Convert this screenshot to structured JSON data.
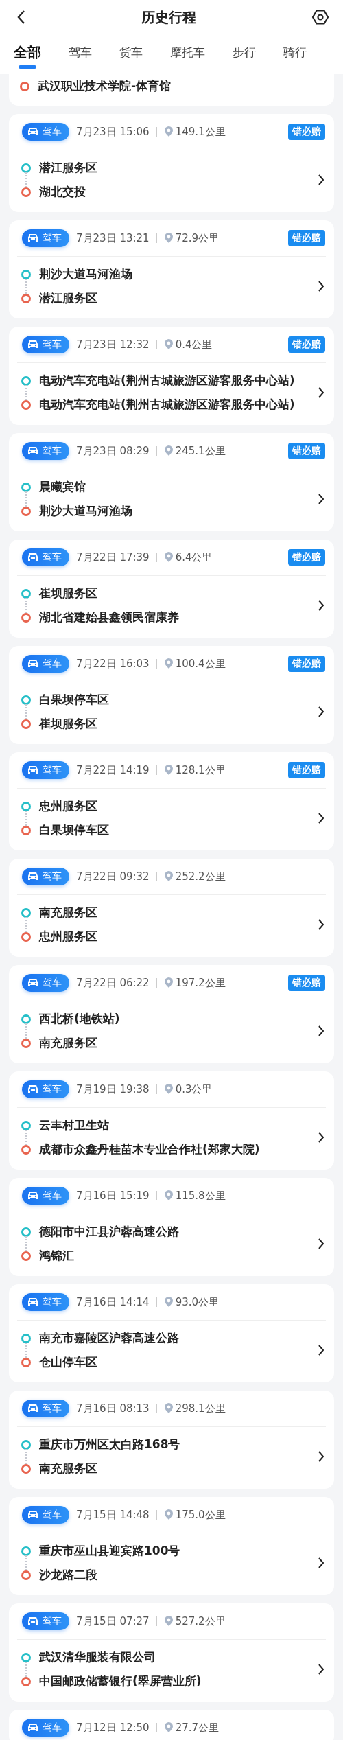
{
  "header": {
    "title": "历史行程"
  },
  "tabs": [
    {
      "label": "全部",
      "selected": true
    },
    {
      "label": "驾车",
      "selected": false
    },
    {
      "label": "货车",
      "selected": false
    },
    {
      "label": "摩托车",
      "selected": false
    },
    {
      "label": "步行",
      "selected": false
    },
    {
      "label": "骑行",
      "selected": false
    }
  ],
  "partial_trip": {
    "end": "武汉职业技术学院-体育馆"
  },
  "trips": [
    {
      "mode": "驾车",
      "time": "7月23日 15:06",
      "distance": "149.1公里",
      "badge": "错必赔",
      "start": "潜江服务区",
      "end": "湖北交投"
    },
    {
      "mode": "驾车",
      "time": "7月23日 13:21",
      "distance": "72.9公里",
      "badge": "错必赔",
      "start": "荆沙大道马河渔场",
      "end": "潜江服务区"
    },
    {
      "mode": "驾车",
      "time": "7月23日 12:32",
      "distance": "0.4公里",
      "badge": "错必赔",
      "start": "电动汽车充电站(荆州古城旅游区游客服务中心站)",
      "end": "电动汽车充电站(荆州古城旅游区游客服务中心站)"
    },
    {
      "mode": "驾车",
      "time": "7月23日 08:29",
      "distance": "245.1公里",
      "badge": "错必赔",
      "start": "晨曦宾馆",
      "end": "荆沙大道马河渔场"
    },
    {
      "mode": "驾车",
      "time": "7月22日 17:39",
      "distance": "6.4公里",
      "badge": "错必赔",
      "start": "崔坝服务区",
      "end": "湖北省建始县鑫领民宿康养"
    },
    {
      "mode": "驾车",
      "time": "7月22日 16:03",
      "distance": "100.4公里",
      "badge": "错必赔",
      "start": "白果坝停车区",
      "end": "崔坝服务区"
    },
    {
      "mode": "驾车",
      "time": "7月22日 14:19",
      "distance": "128.1公里",
      "badge": "错必赔",
      "start": "忠州服务区",
      "end": "白果坝停车区"
    },
    {
      "mode": "驾车",
      "time": "7月22日 09:32",
      "distance": "252.2公里",
      "start": "南充服务区",
      "end": "忠州服务区"
    },
    {
      "mode": "驾车",
      "time": "7月22日 06:22",
      "distance": "197.2公里",
      "badge": "错必赔",
      "start": "西北桥(地铁站)",
      "end": "南充服务区"
    },
    {
      "mode": "驾车",
      "time": "7月19日 19:38",
      "distance": "0.3公里",
      "start": "云丰村卫生站",
      "end": "成都市众鑫丹桂苗木专业合作社(郑家大院)"
    },
    {
      "mode": "驾车",
      "time": "7月16日 15:19",
      "distance": "115.8公里",
      "start": "德阳市中江县沪蓉高速公路",
      "end": "鸿锦汇"
    },
    {
      "mode": "驾车",
      "time": "7月16日 14:14",
      "distance": "93.0公里",
      "start": "南充市嘉陵区沪蓉高速公路",
      "end": "仓山停车区"
    },
    {
      "mode": "驾车",
      "time": "7月16日 08:13",
      "distance": "298.1公里",
      "start": "重庆市万州区太白路168号",
      "end": "南充服务区"
    },
    {
      "mode": "驾车",
      "time": "7月15日 14:48",
      "distance": "175.0公里",
      "start": "重庆市巫山县迎宾路100号",
      "end": "沙龙路二段"
    },
    {
      "mode": "驾车",
      "time": "7月15日 07:27",
      "distance": "527.2公里",
      "start": "武汉清华服装有限公司",
      "end": "中国邮政储蓄银行(翠屏营业所)"
    },
    {
      "mode": "驾车",
      "time": "7月12日 12:50",
      "distance": "27.7公里"
    }
  ]
}
